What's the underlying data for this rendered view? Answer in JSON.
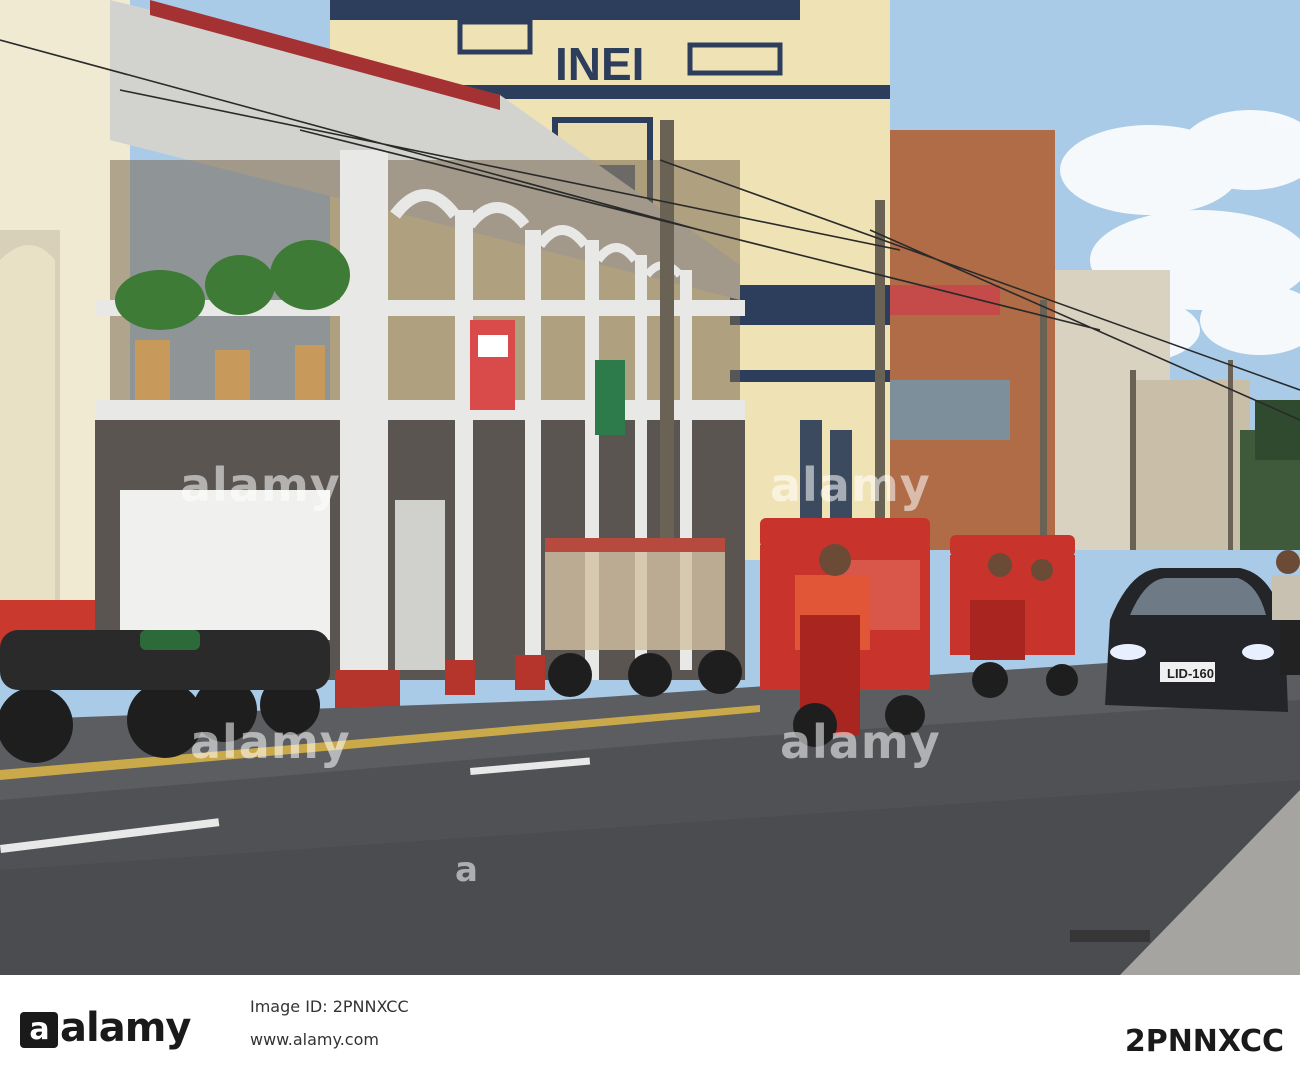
{
  "scene": {
    "building_sign": "INEI",
    "license_plate": "LID-160",
    "watermark_text": "alamy",
    "watermark_symbol": "a"
  },
  "footer": {
    "brand": "alamy",
    "image_id_line": "Image ID: 2PNNXCC",
    "site": "www.alamy.com",
    "image_code": "2PNNXCC"
  },
  "colors": {
    "sky": "#a9cbe8",
    "building_cream": "#efe3b6",
    "road": "#5b5d60",
    "mototaxi_red": "#c8342b",
    "ironwork_white": "#e8e8e6"
  }
}
